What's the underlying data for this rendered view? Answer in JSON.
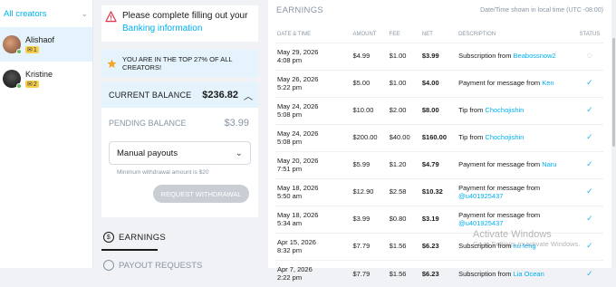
{
  "sidebar": {
    "filter_label": "All creators",
    "creators": [
      {
        "name": "Alishaof",
        "badge_count": "1"
      },
      {
        "name": "Kristine",
        "badge_count": "2"
      }
    ]
  },
  "alert": {
    "text": "Please complete filling out your",
    "link": "Banking information"
  },
  "top_creators": {
    "text": "YOU ARE IN THE TOP 27% OF ALL CREATORS!"
  },
  "balance": {
    "current_label": "CURRENT BALANCE",
    "current_amount": "$236.82",
    "pending_label": "PENDING BALANCE",
    "pending_amount": "$3.99",
    "payout_select": "Manual payouts",
    "min_withdrawal": "Minimum withdrawal amount is $20",
    "request_button": "REQUEST WITHDRAWAL"
  },
  "tabs": {
    "earnings": "EARNINGS",
    "payout_requests": "PAYOUT REQUESTS"
  },
  "earnings": {
    "title": "EARNINGS",
    "note": "Date/Time shown in local time (UTC -08:00)",
    "columns": [
      "DATE & TIME",
      "AMOUNT",
      "FEE",
      "NET",
      "DESCRIPTION",
      "STATUS"
    ],
    "rows": [
      {
        "date": "May 29, 2026",
        "time": "4:08 pm",
        "amount": "$4.99",
        "fee": "$1.00",
        "net": "$3.99",
        "desc": "Subscription from ",
        "link": "Beabossnow2",
        "status": "pending"
      },
      {
        "date": "May 26, 2026",
        "time": "5:22 pm",
        "amount": "$5.00",
        "fee": "$1.00",
        "net": "$4.00",
        "desc": "Payment for message from ",
        "link": "Ken",
        "status": "done"
      },
      {
        "date": "May 24, 2026",
        "time": "5:08 pm",
        "amount": "$10.00",
        "fee": "$2.00",
        "net": "$8.00",
        "desc": "Tip from ",
        "link": "Chochojishin",
        "status": "done"
      },
      {
        "date": "May 24, 2026",
        "time": "5:08 pm",
        "amount": "$200.00",
        "fee": "$40.00",
        "net": "$160.00",
        "desc": "Tip from ",
        "link": "Chochojishin",
        "status": "done"
      },
      {
        "date": "May 20, 2026",
        "time": "7:51 pm",
        "amount": "$5.99",
        "fee": "$1.20",
        "net": "$4.79",
        "desc": "Payment for message from ",
        "link": "Naru",
        "status": "done"
      },
      {
        "date": "May 18, 2026",
        "time": "5:50 am",
        "amount": "$12.90",
        "fee": "$2.58",
        "net": "$10.32",
        "desc": "Payment for message from ",
        "link": "@u401925437",
        "status": "done"
      },
      {
        "date": "May 18, 2026",
        "time": "5:34 am",
        "amount": "$3.99",
        "fee": "$0.80",
        "net": "$3.19",
        "desc": "Payment for message from ",
        "link": "@u401925437",
        "status": "done"
      },
      {
        "date": "Apr 15, 2026",
        "time": "8:32 pm",
        "amount": "$7.79",
        "fee": "$1.56",
        "net": "$6.23",
        "desc": "Subscription from ",
        "link": "nu feng",
        "status": "done"
      },
      {
        "date": "Apr 7, 2026",
        "time": "2:22 pm",
        "amount": "$7.79",
        "fee": "$1.56",
        "net": "$6.23",
        "desc": "Subscription from ",
        "link": "Lia Ocean",
        "status": "done"
      }
    ]
  },
  "watermark": {
    "line1": "Activate Windows",
    "line2": "Go to Settings to activate Windows."
  },
  "colors": {
    "accent": "#00aff0",
    "highlight": "#e5f3fc",
    "check": "#2bb7ea"
  }
}
